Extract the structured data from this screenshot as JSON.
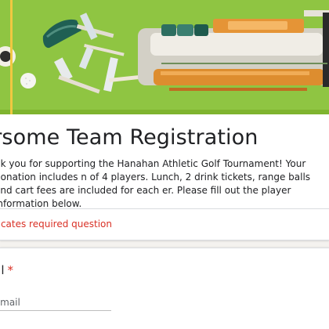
{
  "form": {
    "title": "ursome Team Registration",
    "description": "nk you for supporting the Hanahan Athletic Golf Tournament! Your donation includes n of 4 players. Lunch, 2 drink tickets, range balls and cart fees are included for each er. Please fill out the player information below.",
    "required_note": "dicates required question"
  },
  "question": {
    "label": "ail",
    "required_marker": "*",
    "placeholder": "r email",
    "value": ""
  },
  "banner": {
    "background_color": "#8fc43a",
    "accent_color": "#e69a3c",
    "club_color": "#2f7f6a",
    "icons": [
      "golf-bag-icon",
      "golf-club-icon",
      "golf-ball-icon",
      "flag-icon"
    ]
  }
}
